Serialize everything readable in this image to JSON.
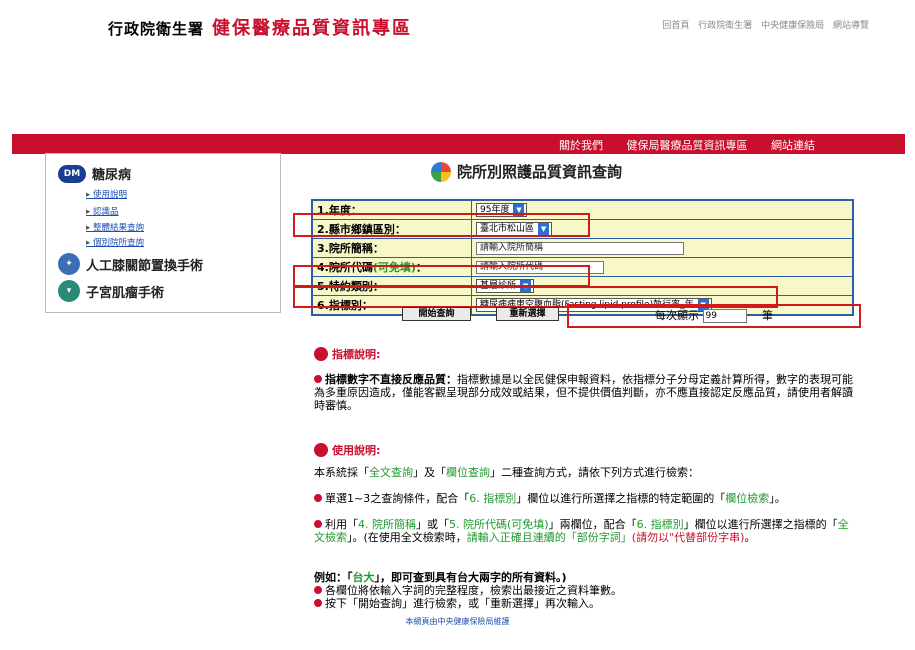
{
  "header": {
    "agency": "行政院衛生署",
    "site": "健保醫療品質資訊專區",
    "toplinks": [
      "回首頁",
      "行政院衛生署",
      "中央健康保險局",
      "網站導覽"
    ]
  },
  "redbar": {
    "links": [
      "關於我們",
      "健保局醫療品質資訊專區",
      "網站連結"
    ]
  },
  "sidebar": {
    "diabetes": {
      "badge": "DM",
      "title": "糖尿病",
      "items": [
        "使用說明",
        "認識品",
        "整體結果查詢",
        "個別院所查詢"
      ]
    },
    "knee": {
      "title": "人工膝關節置換手術"
    },
    "uterus": {
      "title": "子宮肌瘤手術"
    }
  },
  "main": {
    "title": "院所別照護品質資訊查詢"
  },
  "form": {
    "year_label": "1.年度：",
    "year_value": "95年度",
    "county_label": "2.縣市鄉鎮區別：",
    "county_value": "臺北市松山區",
    "hosp_name_label": "3.院所簡稱：",
    "hosp_name_placeholder": "請輸入院所簡稱",
    "hosp_code_label": "4.院所代碼",
    "hosp_code_optional": "(可免填)",
    "hosp_code_colon": "：",
    "hosp_code_placeholder": "請輸入院所代碼",
    "level_label": "5.特約類別：",
    "level_value": "基層診所",
    "indicator_label": "6.指標別：",
    "indicator_value": "糖尿病病患空腹血脂(Fasting lipid profile)執行率_年"
  },
  "buttons": {
    "search": "開始查詢",
    "reset": "重新選擇"
  },
  "perpage": {
    "prefix": "每次顯示",
    "value": "99",
    "suffix": "筆"
  },
  "indicator_note": {
    "heading": "指標說明:",
    "lead": "指標數字不直接反應品質：",
    "body": "指標數據是以全民健保申報資料，依指標分子分母定義計算所得，數字的表現可能為多重原因造成，僅能客觀呈現部分成效或結果，但不提供價值判斷，亦不應直接認定反應品質，請使用者解讀時審慎。"
  },
  "usage": {
    "heading": "使用說明:",
    "intro_1": "本系統採「",
    "intro_full": "全文查詢",
    "intro_2": "」及「",
    "intro_field": "欄位查詢",
    "intro_3": "」二種查詢方式，請依下列方式進行檢索：",
    "b1_1": "單選1~3之查詢條件，配合「",
    "b1_2": "6. 指標別",
    "b1_3": "」欄位以進行所選擇之指標的特定範圍的「",
    "b1_4": "欄位檢索",
    "b1_5": "」。",
    "b2_1": "利用「",
    "b2_2": "4. 院所簡稱",
    "b2_3": "」或「",
    "b2_4": "5. 院所代碼(可免填)",
    "b2_5": "」兩欄位，配合「",
    "b2_6": "6. 指標別",
    "b2_7": "」欄位以進行所選擇之指標的「",
    "b2_8": "全文檢索",
    "b2_9": "」。(在使用全文檢索時，",
    "b2_10": "請輸入正確且連續的「部份字詞」",
    "b2_11": "(請勿以\"代替部份字串)",
    "b2_12": "。",
    "example_1": "例如：「",
    "example_2": "台大",
    "example_3": "」，即可查到具有台大兩字的所有資料。)",
    "b3": "各欄位將依輸入字詞的完整程度，檢索出最接近之資料筆數。",
    "b4": "按下「開始查詢」進行檢索，或「重新選擇」再次輸入。"
  },
  "footer": "本網頁由中央健康保險局維護"
}
